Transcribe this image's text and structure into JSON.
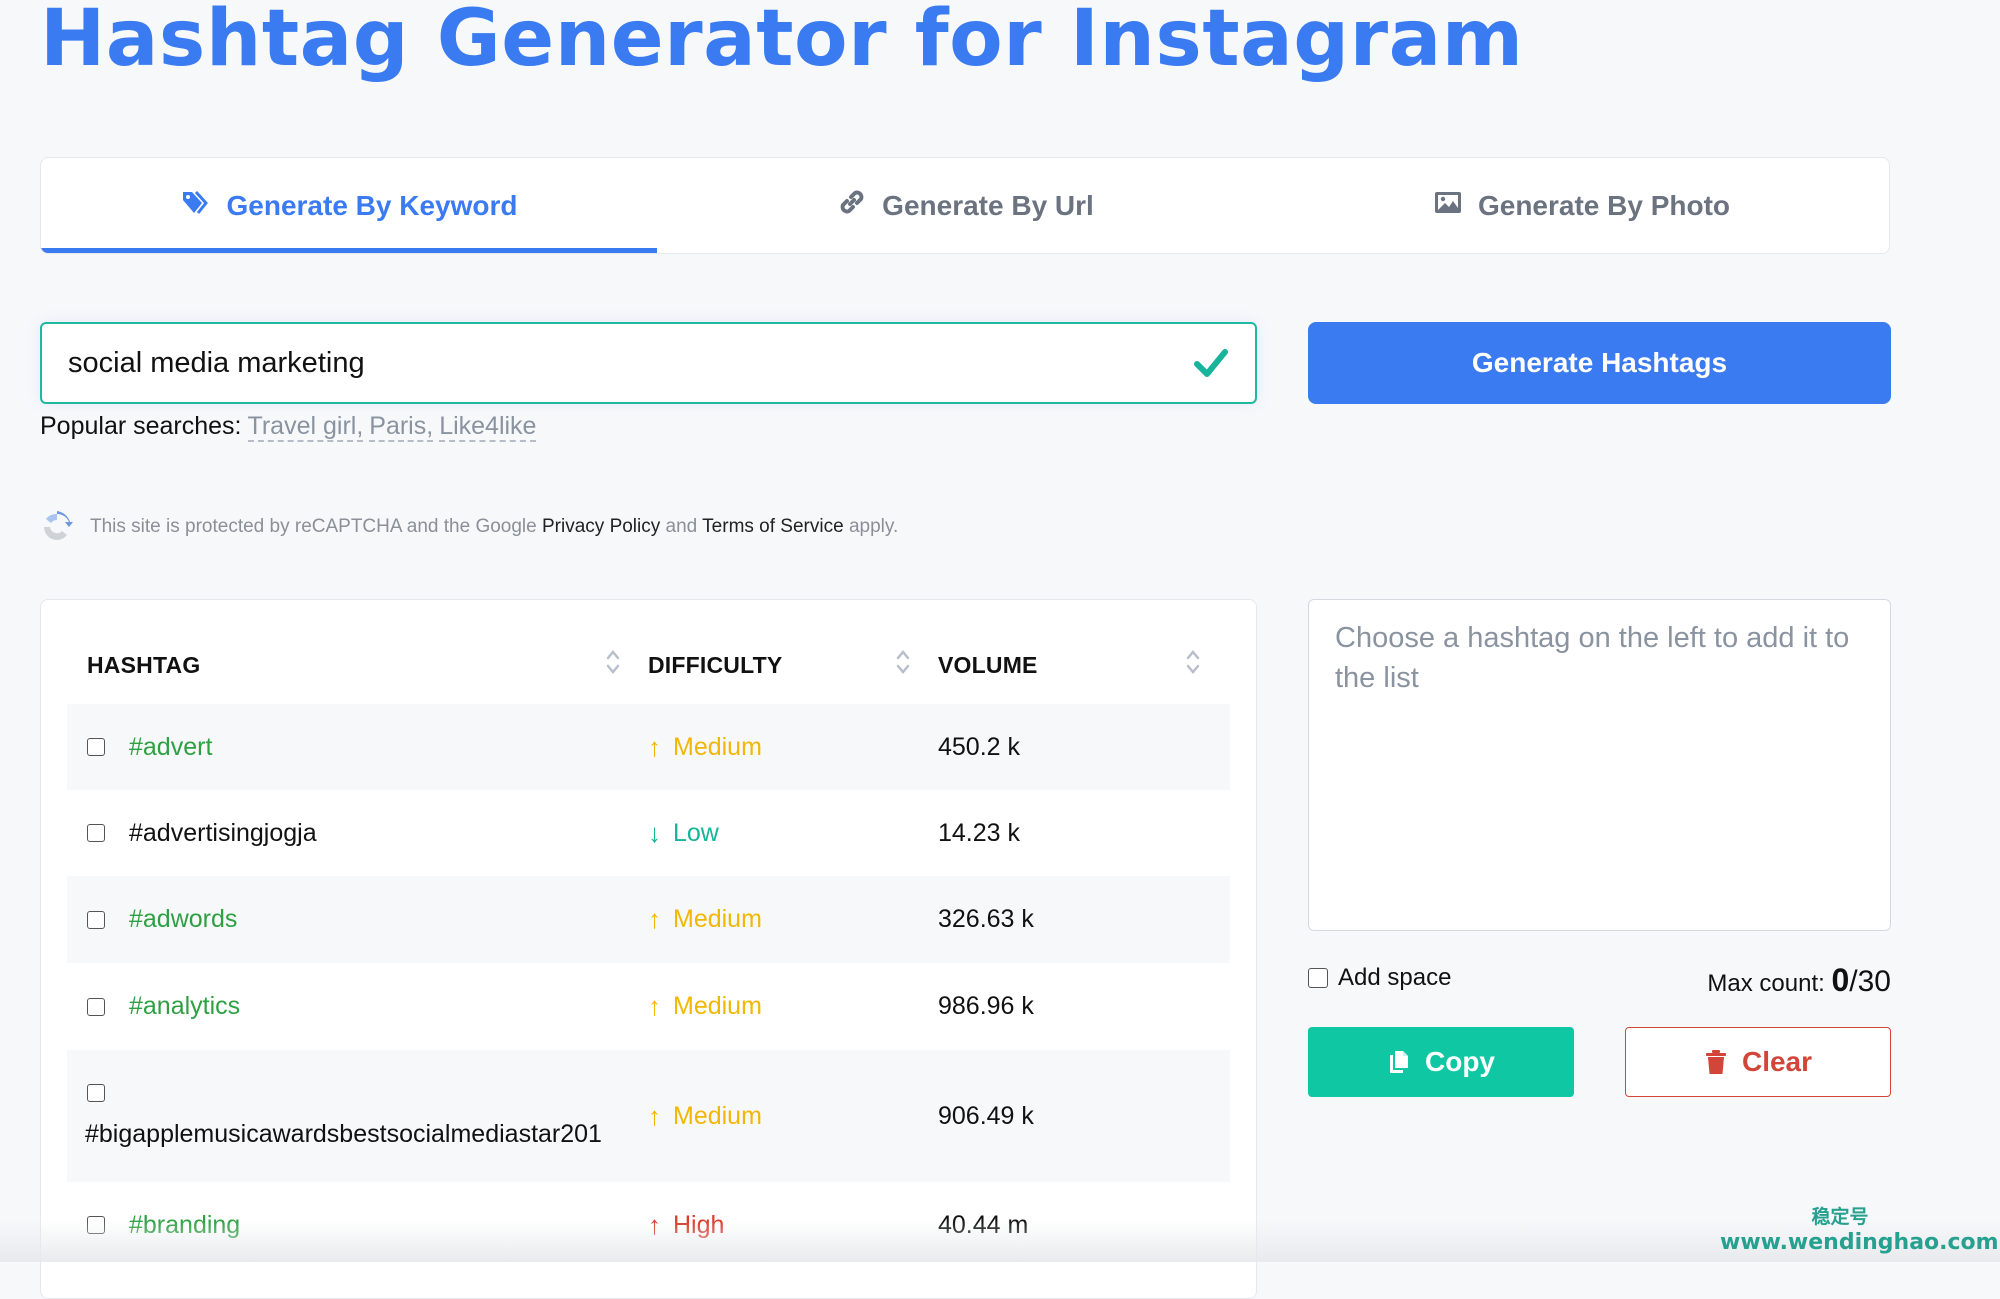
{
  "page": {
    "title": "Hashtag Generator for Instagram"
  },
  "tabs": [
    {
      "label": "Generate By Keyword",
      "icon": "tags-icon",
      "active": true
    },
    {
      "label": "Generate By Url",
      "icon": "link-icon",
      "active": false
    },
    {
      "label": "Generate By Photo",
      "icon": "image-icon",
      "active": false
    }
  ],
  "search": {
    "value": "social media marketing",
    "valid_icon": "check-icon",
    "button_label": "Generate Hashtags"
  },
  "popular": {
    "label": "Popular searches:",
    "items": [
      "Travel girl,",
      "Paris,",
      "Like4like"
    ]
  },
  "recaptcha": {
    "prefix": "This site is protected by reCAPTCHA and the Google",
    "privacy": "Privacy Policy",
    "and": "and",
    "terms": "Terms of Service",
    "suffix": "apply."
  },
  "table": {
    "columns": [
      "HASHTAG",
      "DIFFICULTY",
      "VOLUME"
    ],
    "rows": [
      {
        "hashtag": "#advert",
        "difficulty": "Medium",
        "trend": "up",
        "volume": "450.2 k",
        "checked": false
      },
      {
        "hashtag": "#advertisingjogja",
        "difficulty": "Low",
        "trend": "down",
        "volume": "14.23 k",
        "checked": false
      },
      {
        "hashtag": "#adwords",
        "difficulty": "Medium",
        "trend": "up",
        "volume": "326.63 k",
        "checked": false
      },
      {
        "hashtag": "#analytics",
        "difficulty": "Medium",
        "trend": "up",
        "volume": "986.96 k",
        "checked": false
      },
      {
        "hashtag": "#bigapplemusicawardsbestsocialmediastar201",
        "difficulty": "Medium",
        "trend": "up",
        "volume": "906.49 k",
        "checked": false
      },
      {
        "hashtag": "#branding",
        "difficulty": "High",
        "trend": "up",
        "volume": "40.44 m",
        "checked": false
      }
    ]
  },
  "selection": {
    "placeholder": "Choose a hashtag on the left to add it to the list",
    "add_space_label": "Add space",
    "add_space_checked": false,
    "max_count_label": "Max count:",
    "count": "0",
    "max": "/30",
    "copy_label": "Copy",
    "clear_label": "Clear"
  },
  "watermark": {
    "cn": "稳定号",
    "url": "www.wendinghao.com"
  },
  "colors": {
    "brand": "#3b7bf2",
    "copy": "#0fc7a3",
    "clear": "#d2463a",
    "medium": "#f2b705",
    "low": "#17b39a",
    "high": "#d93a2b",
    "hashtag_green": "#2ea043"
  }
}
